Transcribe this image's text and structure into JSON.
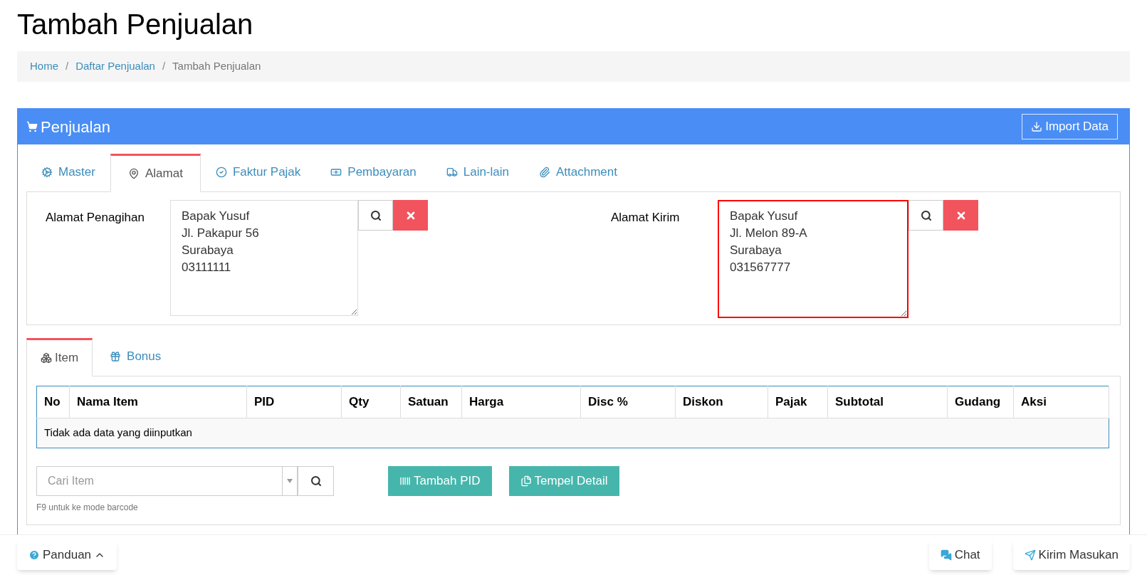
{
  "page_title": "Tambah Penjualan",
  "breadcrumb": [
    {
      "label": "Home",
      "link": true
    },
    {
      "label": "Daftar Penjualan",
      "link": true
    },
    {
      "label": "Tambah Penjualan",
      "link": false
    }
  ],
  "breadcrumb_separator": "/",
  "panel": {
    "title": "Penjualan",
    "import_button": "Import Data"
  },
  "tabs": [
    {
      "label": "Master",
      "selected": false
    },
    {
      "label": "Alamat",
      "selected": true
    },
    {
      "label": "Faktur Pajak",
      "selected": false
    },
    {
      "label": "Pembayaran",
      "selected": false
    },
    {
      "label": "Lain-lain",
      "selected": false
    },
    {
      "label": "Attachment",
      "selected": false
    }
  ],
  "addresses": [
    {
      "label": "Alamat Penagihan",
      "lines": [
        "Bapak Yusuf",
        "Jl. Pakapur 56",
        "Surabaya",
        "03111111"
      ],
      "highlighted": false
    },
    {
      "label": "Alamat Kirim",
      "lines": [
        "Bapak Yusuf",
        "Jl. Melon 89-A",
        "Surabaya",
        "031567777"
      ],
      "highlighted": true
    }
  ],
  "item_tabs": [
    {
      "label": "Item",
      "selected": true
    },
    {
      "label": "Bonus",
      "selected": false
    }
  ],
  "table": {
    "columns": [
      "No",
      "Nama Item",
      "PID",
      "Qty",
      "Satuan",
      "Harga",
      "Disc %",
      "Diskon",
      "Pajak",
      "Subtotal",
      "Gudang",
      "Aksi"
    ],
    "empty_message": "Tidak ada data yang diinputkan"
  },
  "item_search": {
    "placeholder": "Cari Item",
    "hint": "F9 untuk ke mode barcode"
  },
  "action_buttons": [
    {
      "label": "Tambah PID"
    },
    {
      "label": "Tempel Detail"
    }
  ],
  "footer": {
    "guide_button": "Panduan",
    "chat_button": "Chat",
    "feedback_button": "Kirim Masukan"
  }
}
